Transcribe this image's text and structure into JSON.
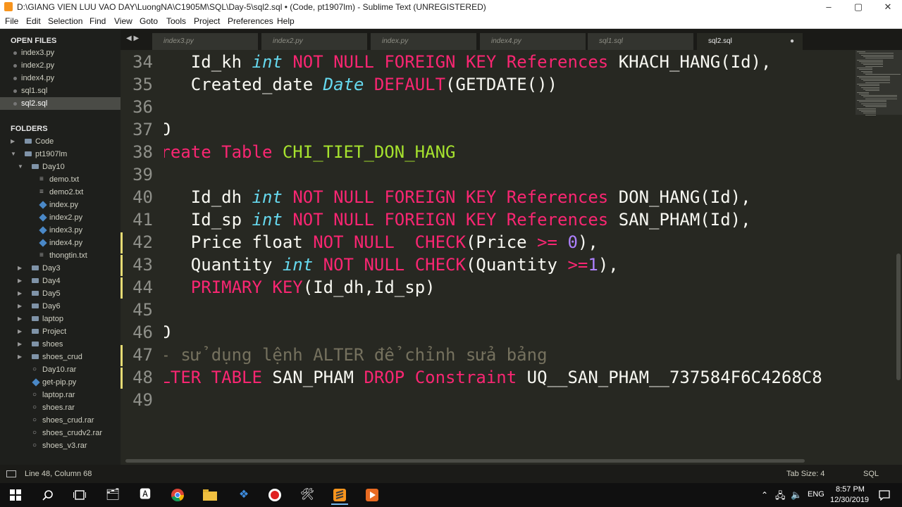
{
  "window": {
    "title": "D:\\GIANG VIEN LUU VAO DAY\\LuongNA\\C1905M\\SQL\\Day-5\\sql2.sql • (Code, pt1907lm) - Sublime Text (UNREGISTERED)",
    "minimize": "–",
    "maximize": "▢",
    "close": "✕"
  },
  "menu": [
    "File",
    "Edit",
    "Selection",
    "Find",
    "View",
    "Goto",
    "Tools",
    "Project",
    "Preferences",
    "Help"
  ],
  "sidebar": {
    "open_files_title": "OPEN FILES",
    "open_files": [
      "index3.py",
      "index2.py",
      "index4.py",
      "sql1.sql",
      "sql2.sql"
    ],
    "folders_title": "FOLDERS",
    "tree": [
      {
        "label": "Code",
        "kind": "folder",
        "depth": 0,
        "open": false
      },
      {
        "label": "pt1907lm",
        "kind": "folder",
        "depth": 0,
        "open": true
      },
      {
        "label": "Day10",
        "kind": "folder",
        "depth": 1,
        "open": true
      },
      {
        "label": "demo.txt",
        "kind": "file",
        "depth": 2
      },
      {
        "label": "demo2.txt",
        "kind": "file",
        "depth": 2
      },
      {
        "label": "index.py",
        "kind": "py",
        "depth": 2
      },
      {
        "label": "index2.py",
        "kind": "py",
        "depth": 2
      },
      {
        "label": "index3.py",
        "kind": "py",
        "depth": 2
      },
      {
        "label": "index4.py",
        "kind": "py",
        "depth": 2
      },
      {
        "label": "thongtin.txt",
        "kind": "file",
        "depth": 2
      },
      {
        "label": "Day3",
        "kind": "folder",
        "depth": 1,
        "open": false
      },
      {
        "label": "Day4",
        "kind": "folder",
        "depth": 1,
        "open": false
      },
      {
        "label": "Day5",
        "kind": "folder",
        "depth": 1,
        "open": false
      },
      {
        "label": "Day6",
        "kind": "folder",
        "depth": 1,
        "open": false
      },
      {
        "label": "laptop",
        "kind": "folder",
        "depth": 1,
        "open": false
      },
      {
        "label": "Project",
        "kind": "folder",
        "depth": 1,
        "open": false
      },
      {
        "label": "shoes",
        "kind": "folder",
        "depth": 1,
        "open": false
      },
      {
        "label": "shoes_crud",
        "kind": "folder",
        "depth": 1,
        "open": false
      },
      {
        "label": "Day10.rar",
        "kind": "rar",
        "depth": 1
      },
      {
        "label": "get-pip.py",
        "kind": "py",
        "depth": 1
      },
      {
        "label": "laptop.rar",
        "kind": "rar",
        "depth": 1
      },
      {
        "label": "shoes.rar",
        "kind": "rar",
        "depth": 1
      },
      {
        "label": "shoes_crud.rar",
        "kind": "rar",
        "depth": 1
      },
      {
        "label": "shoes_crudv2.rar",
        "kind": "rar",
        "depth": 1
      },
      {
        "label": "shoes_v3.rar",
        "kind": "rar",
        "depth": 1
      }
    ]
  },
  "tabs": {
    "nav": "◀ ▶",
    "items": [
      "index3.py",
      "index2.py",
      "index.py",
      "index4.py",
      "sql1.sql",
      "sql2.sql"
    ],
    "dirty_mark": "●"
  },
  "editor": {
    "line_numbers": [
      "34",
      "35",
      "36",
      "37",
      "38",
      "39",
      "40",
      "41",
      "42",
      "43",
      "44",
      "45",
      "46",
      "47",
      "48",
      "49"
    ],
    "lines": [
      [
        {
          "t": "    Id_kh "
        },
        {
          "t": "int",
          "c": "t"
        },
        {
          "t": " "
        },
        {
          "t": "NOT NULL FOREIGN KEY References",
          "c": "k"
        },
        {
          "t": " KHACH_HANG(Id),"
        }
      ],
      [
        {
          "t": "    Created_date "
        },
        {
          "t": "Date",
          "c": "t"
        },
        {
          "t": " "
        },
        {
          "t": "DEFAULT",
          "c": "k"
        },
        {
          "t": "(GETDATE())"
        }
      ],
      [
        {
          "t": ")"
        }
      ],
      [
        {
          "t": "GO"
        }
      ],
      [
        {
          "t": "Create Table",
          "c": "k"
        },
        {
          "t": " "
        },
        {
          "t": "CHI_TIET_DON_HANG",
          "c": "g"
        }
      ],
      [
        {
          "t": "("
        }
      ],
      [
        {
          "t": "    Id_dh "
        },
        {
          "t": "int",
          "c": "t"
        },
        {
          "t": " "
        },
        {
          "t": "NOT NULL FOREIGN KEY References",
          "c": "k"
        },
        {
          "t": " DON_HANG(Id),"
        }
      ],
      [
        {
          "t": "    Id_sp "
        },
        {
          "t": "int",
          "c": "t"
        },
        {
          "t": " "
        },
        {
          "t": "NOT NULL FOREIGN KEY References",
          "c": "k"
        },
        {
          "t": " SAN_PHAM(Id),"
        }
      ],
      [
        {
          "t": "    Price float "
        },
        {
          "t": "NOT NULL  CHECK",
          "c": "k"
        },
        {
          "t": "(Price "
        },
        {
          "t": ">=",
          "c": "k"
        },
        {
          "t": " "
        },
        {
          "t": "0",
          "c": "n"
        },
        {
          "t": "),"
        }
      ],
      [
        {
          "t": "    Quantity "
        },
        {
          "t": "int",
          "c": "t"
        },
        {
          "t": " "
        },
        {
          "t": "NOT NULL CHECK",
          "c": "k"
        },
        {
          "t": "(Quantity "
        },
        {
          "t": ">=",
          "c": "k"
        },
        {
          "t": "1",
          "c": "n"
        },
        {
          "t": "),"
        }
      ],
      [
        {
          "t": "    "
        },
        {
          "t": "PRIMARY KEY",
          "c": "k"
        },
        {
          "t": "(Id_dh,Id_sp)"
        }
      ],
      [
        {
          "t": ")"
        }
      ],
      [
        {
          "t": "GO"
        }
      ],
      [
        {
          "t": "-- sử dụng lệnh ALTER để chỉnh sửa bảng",
          "c": "c"
        }
      ],
      [
        {
          "t": "ALTER TABLE",
          "c": "k"
        },
        {
          "t": " SAN_PHAM "
        },
        {
          "t": "DROP",
          "c": "k"
        },
        {
          "t": " "
        },
        {
          "t": "Constraint",
          "c": "k"
        },
        {
          "t": " UQ__SAN_PHAM__737584F6C4268C8"
        }
      ],
      [
        {
          "t": ""
        }
      ]
    ],
    "modified_lines": [
      "42",
      "43",
      "44",
      "47",
      "48"
    ]
  },
  "status": {
    "position": "Line 48, Column 68",
    "tab_size": "Tab Size: 4",
    "syntax": "SQL"
  },
  "taskbar": {
    "lang": "ENG",
    "time": "8:57 PM",
    "date": "12/30/2019"
  }
}
